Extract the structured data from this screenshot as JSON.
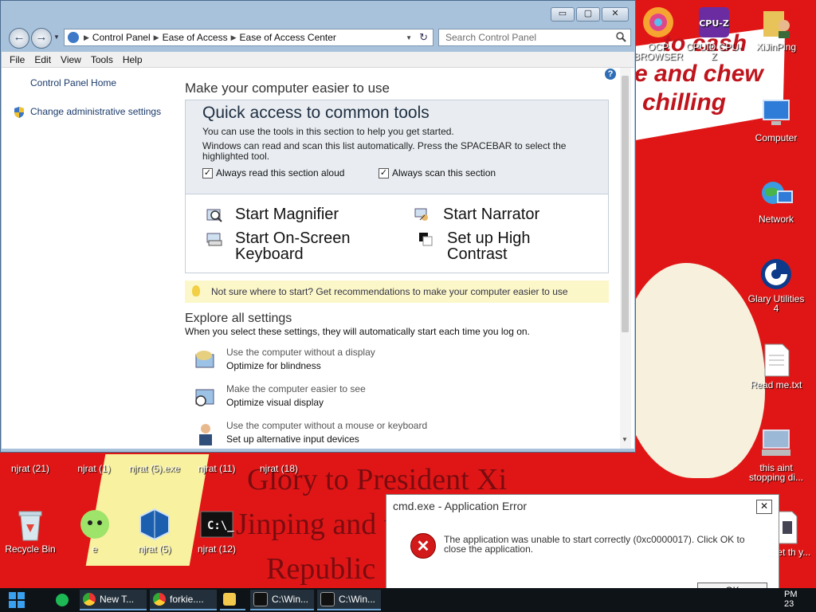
{
  "desktop": {
    "wallpaper_text": [
      "to cash",
      "e and chew",
      "chilling",
      "Glory to President Xi",
      "Jinping and t",
      "Republic"
    ],
    "icons_right": [
      {
        "label": "OCP BROWSER",
        "icon": "browser-icon"
      },
      {
        "label": "CPUID CPU-Z",
        "icon": "cpuz-icon"
      },
      {
        "label": "XiJinPing",
        "icon": "folder-user-icon"
      },
      {
        "label": "Computer",
        "icon": "computer-icon"
      },
      {
        "label": "Network",
        "icon": "network-icon"
      },
      {
        "label": "Glary Utilities 4",
        "icon": "glary-icon"
      },
      {
        "label": "Read me.txt",
        "icon": "text-file-icon"
      },
      {
        "label": "this aint stopping di...",
        "icon": "computer-icon"
      },
      {
        "label": "forget th y...",
        "icon": "file-icon"
      }
    ],
    "icons_bottom": [
      {
        "label": "njrat (21)"
      },
      {
        "label": "njrat (1)"
      },
      {
        "label": "njrat (5).exe"
      },
      {
        "label": "njrat (11)"
      },
      {
        "label": "njrat (18)"
      },
      {
        "label": "Recycle Bin"
      },
      {
        "label": "e"
      },
      {
        "label": "njrat (5)"
      },
      {
        "label": "njrat (12)"
      }
    ]
  },
  "window": {
    "buttons": {
      "minimize": "▭",
      "maximize": "▢",
      "close": "✕"
    },
    "breadcrumb": [
      "Control Panel",
      "Ease of Access",
      "Ease of Access Center"
    ],
    "search_placeholder": "Search Control Panel",
    "menu": [
      "File",
      "Edit",
      "View",
      "Tools",
      "Help"
    ],
    "left_pane": {
      "home": "Control Panel Home",
      "admin": "Change administrative settings"
    },
    "heading": "Make your computer easier to use",
    "quick_access": {
      "title": "Quick access to common tools",
      "text1": "You can use the tools in this section to help you get started.",
      "text2": "Windows can read and scan this list automatically.  Press the SPACEBAR to select the highlighted tool.",
      "check_read": "Always read this section aloud",
      "check_scan": "Always scan this section",
      "check_read_on": true,
      "check_scan_on": true,
      "tools": [
        "Start Magnifier",
        "Start Narrator",
        "Start On-Screen Keyboard",
        "Set up High Contrast"
      ]
    },
    "tip": "Not sure where to start? Get recommendations to make your computer easier to use",
    "explore": {
      "title": "Explore all settings",
      "subtitle": "When you select these settings, they will automatically start each time you log on.",
      "items": [
        {
          "desc": "Use the computer without a display",
          "link": "Optimize for blindness"
        },
        {
          "desc": "Make the computer easier to see",
          "link": "Optimize visual display"
        },
        {
          "desc": "Use the computer without a mouse or keyboard",
          "link": "Set up alternative input devices"
        }
      ]
    }
  },
  "error_dialog": {
    "title": "cmd.exe - Application Error",
    "message": "The application was unable to start correctly (0xc0000017). Click OK to close the application.",
    "ok": "OK",
    "close": "✕"
  },
  "taskbar": {
    "items": [
      "New T...",
      "forkie....",
      "C:\\Win...",
      "C:\\Win..."
    ],
    "clock_time": "PM",
    "clock_date": "23"
  }
}
